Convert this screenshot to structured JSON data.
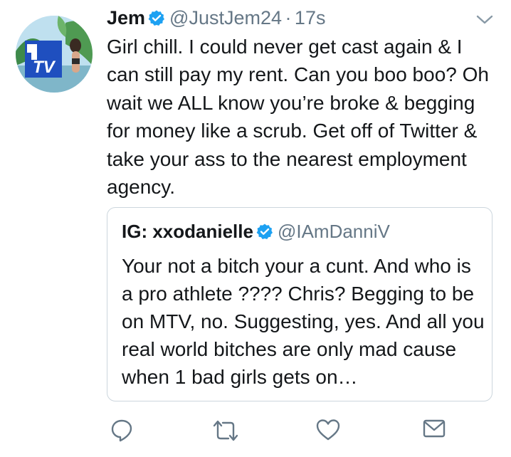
{
  "tweet": {
    "name": "Jem",
    "handle": "@JustJem24",
    "separator": "·",
    "time": "17s",
    "text": "Girl chill. I could never get cast again & I can still pay my rent. Can you boo boo? Oh wait we ALL know you’re broke & begging for money like a scrub. Get off of Twitter & take your ass to the nearest employment agency.",
    "avatar_logo_text": "TV"
  },
  "quote": {
    "name": "IG: xxodanielle",
    "handle": "@IAmDanniV",
    "text": "Your not a bitch your a cunt. And who is a pro athlete ???? Chris? Begging to be on MTV, no. Suggesting, yes. And all you real world bitches are only mad cause when 1 bad girls gets on…"
  },
  "icons": {
    "verified": "verified-badge-icon",
    "caret": "chevron-down-icon",
    "reply": "reply-icon",
    "retweet": "retweet-icon",
    "like": "heart-icon",
    "dm": "envelope-icon"
  },
  "colors": {
    "text": "#14171a",
    "secondary": "#657786",
    "verified": "#1da1f2",
    "border": "#ccd6dd"
  }
}
